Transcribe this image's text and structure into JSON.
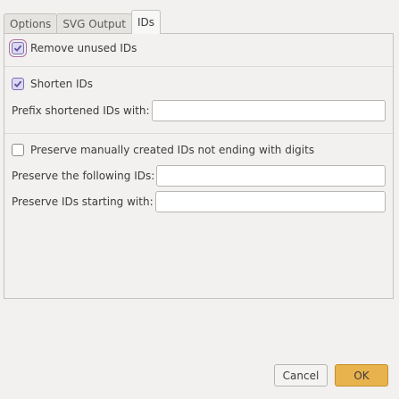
{
  "tabs": [
    {
      "label": "Options"
    },
    {
      "label": "SVG Output"
    },
    {
      "label": "IDs"
    }
  ],
  "ids_panel": {
    "remove_unused": {
      "label": "Remove unused IDs",
      "checked": true
    },
    "shorten": {
      "label": "Shorten IDs",
      "checked": true
    },
    "prefix": {
      "label": "Prefix shortened IDs with:",
      "value": ""
    },
    "preserve_manual": {
      "label": "Preserve manually created IDs not ending with digits",
      "checked": false
    },
    "preserve_following": {
      "label": "Preserve the following IDs:",
      "value": ""
    },
    "preserve_starting": {
      "label": "Preserve IDs starting with:",
      "value": ""
    }
  },
  "buttons": {
    "cancel": "Cancel",
    "ok": "OK"
  },
  "colors": {
    "accent_ok": "#e8b24d",
    "check_fill": "#dcd8f0",
    "check_mark": "#5a4e9e"
  }
}
